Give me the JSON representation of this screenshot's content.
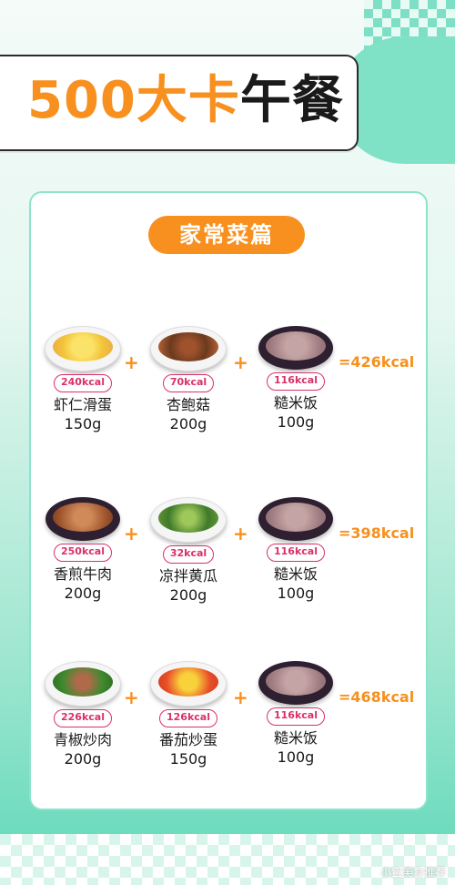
{
  "title": {
    "num": "500",
    "part1": "大卡",
    "part2": "午餐"
  },
  "section": "家常菜篇",
  "rows": [
    {
      "items": [
        {
          "kcal": "240kcal",
          "name": "虾仁滑蛋",
          "weight": "150g"
        },
        {
          "kcal": "70kcal",
          "name": "杏鲍菇",
          "weight": "200g"
        },
        {
          "kcal": "116kcal",
          "name": "糙米饭",
          "weight": "100g"
        }
      ],
      "total": "=426kcal"
    },
    {
      "items": [
        {
          "kcal": "250kcal",
          "name": "香煎牛肉",
          "weight": "200g"
        },
        {
          "kcal": "32kcal",
          "name": "凉拌黄瓜",
          "weight": "200g"
        },
        {
          "kcal": "116kcal",
          "name": "糙米饭",
          "weight": "100g"
        }
      ],
      "total": "=398kcal"
    },
    {
      "items": [
        {
          "kcal": "226kcal",
          "name": "青椒炒肉",
          "weight": "200g"
        },
        {
          "kcal": "126kcal",
          "name": "番茄炒蛋",
          "weight": "150g"
        },
        {
          "kcal": "116kcal",
          "name": "糙米饭",
          "weight": "100g"
        }
      ],
      "total": "=468kcal"
    }
  ],
  "plus": "+",
  "watermark": "小宝美食推荐",
  "colors": {
    "accent": "#f7901e",
    "kcal_badge": "#d8316a",
    "mint": "#5fd8b8"
  }
}
